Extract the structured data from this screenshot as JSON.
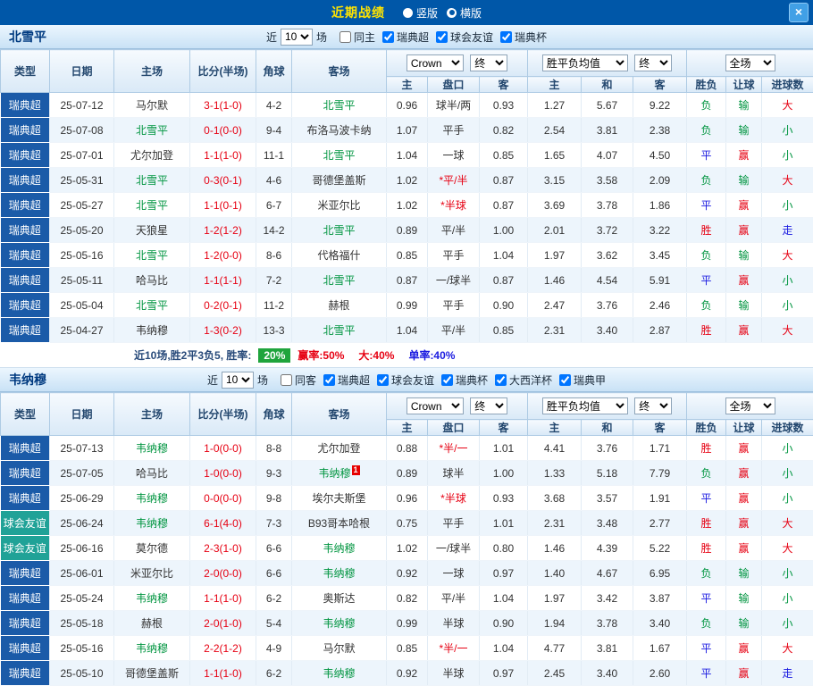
{
  "topbar": {
    "title": "近期战绩",
    "views": [
      {
        "label": "竖版",
        "selected": false
      },
      {
        "label": "横版",
        "selected": true
      }
    ],
    "close": "×"
  },
  "table_header": {
    "type": "类型",
    "date": "日期",
    "home": "主场",
    "score": "比分(半场)",
    "corner": "角球",
    "away": "客场",
    "asian": {
      "bookmaker": "Crown",
      "stage": "终",
      "home": "主",
      "handicap": "盘口",
      "away": "客"
    },
    "europe": {
      "label": "胜平负均值",
      "stage": "终",
      "home": "主",
      "draw": "和",
      "away": "客"
    },
    "result": {
      "label": "全场",
      "wdl": "胜负",
      "handicap": "让球",
      "goals": "进球数"
    }
  },
  "sections": [
    {
      "team": "北雪平",
      "near_label": "近",
      "count": "10",
      "games_label": "场",
      "checkboxes": [
        {
          "label": "同主",
          "checked": false
        },
        {
          "label": "瑞典超",
          "checked": true
        },
        {
          "label": "球会友谊",
          "checked": true
        },
        {
          "label": "瑞典杯",
          "checked": true
        }
      ],
      "rows": [
        {
          "league": "瑞典超",
          "league_type": "super",
          "date": "25-07-12",
          "home": "马尔默",
          "home_focus": false,
          "score": "3-1(1-0)",
          "corner": "4-2",
          "away": "北雪平",
          "away_focus": true,
          "away_card": "",
          "asian_home": "0.96",
          "handicap": "球半/两",
          "handicap_red": false,
          "asian_away": "0.93",
          "euro_home": "1.27",
          "euro_draw": "5.67",
          "euro_away": "9.22",
          "wdl": "负",
          "wdl_c": "green",
          "let": "输",
          "let_c": "green",
          "goal": "大",
          "goal_c": "red"
        },
        {
          "league": "瑞典超",
          "league_type": "super",
          "date": "25-07-08",
          "home": "北雪平",
          "home_focus": true,
          "score": "0-1(0-0)",
          "corner": "9-4",
          "away": "布洛马波卡纳",
          "away_focus": false,
          "away_card": "",
          "asian_home": "1.07",
          "handicap": "平手",
          "handicap_red": false,
          "asian_away": "0.82",
          "euro_home": "2.54",
          "euro_draw": "3.81",
          "euro_away": "2.38",
          "wdl": "负",
          "wdl_c": "green",
          "let": "输",
          "let_c": "green",
          "goal": "小",
          "goal_c": "green"
        },
        {
          "league": "瑞典超",
          "league_type": "super",
          "date": "25-07-01",
          "home": "尤尔加登",
          "home_focus": false,
          "score": "1-1(1-0)",
          "corner": "11-1",
          "away": "北雪平",
          "away_focus": true,
          "away_card": "",
          "asian_home": "1.04",
          "handicap": "一球",
          "handicap_red": false,
          "asian_away": "0.85",
          "euro_home": "1.65",
          "euro_draw": "4.07",
          "euro_away": "4.50",
          "wdl": "平",
          "wdl_c": "blue",
          "let": "赢",
          "let_c": "red",
          "goal": "小",
          "goal_c": "green"
        },
        {
          "league": "瑞典超",
          "league_type": "super",
          "date": "25-05-31",
          "home": "北雪平",
          "home_focus": true,
          "score": "0-3(0-1)",
          "corner": "4-6",
          "away": "哥德堡盖斯",
          "away_focus": false,
          "away_card": "",
          "asian_home": "1.02",
          "handicap": "*平/半",
          "handicap_red": true,
          "asian_away": "0.87",
          "euro_home": "3.15",
          "euro_draw": "3.58",
          "euro_away": "2.09",
          "wdl": "负",
          "wdl_c": "green",
          "let": "输",
          "let_c": "green",
          "goal": "大",
          "goal_c": "red"
        },
        {
          "league": "瑞典超",
          "league_type": "super",
          "date": "25-05-27",
          "home": "北雪平",
          "home_focus": true,
          "score": "1-1(0-1)",
          "corner": "6-7",
          "away": "米亚尔比",
          "away_focus": false,
          "away_card": "",
          "asian_home": "1.02",
          "handicap": "*半球",
          "handicap_red": true,
          "asian_away": "0.87",
          "euro_home": "3.69",
          "euro_draw": "3.78",
          "euro_away": "1.86",
          "wdl": "平",
          "wdl_c": "blue",
          "let": "赢",
          "let_c": "red",
          "goal": "小",
          "goal_c": "green"
        },
        {
          "league": "瑞典超",
          "league_type": "super",
          "date": "25-05-20",
          "home": "天狼星",
          "home_focus": false,
          "score": "1-2(1-2)",
          "corner": "14-2",
          "away": "北雪平",
          "away_focus": true,
          "away_card": "",
          "asian_home": "0.89",
          "handicap": "平/半",
          "handicap_red": false,
          "asian_away": "1.00",
          "euro_home": "2.01",
          "euro_draw": "3.72",
          "euro_away": "3.22",
          "wdl": "胜",
          "wdl_c": "red",
          "let": "赢",
          "let_c": "red",
          "goal": "走",
          "goal_c": "blue"
        },
        {
          "league": "瑞典超",
          "league_type": "super",
          "date": "25-05-16",
          "home": "北雪平",
          "home_focus": true,
          "score": "1-2(0-0)",
          "corner": "8-6",
          "away": "代格福什",
          "away_focus": false,
          "away_card": "",
          "asian_home": "0.85",
          "handicap": "平手",
          "handicap_red": false,
          "asian_away": "1.04",
          "euro_home": "1.97",
          "euro_draw": "3.62",
          "euro_away": "3.45",
          "wdl": "负",
          "wdl_c": "green",
          "let": "输",
          "let_c": "green",
          "goal": "大",
          "goal_c": "red"
        },
        {
          "league": "瑞典超",
          "league_type": "super",
          "date": "25-05-11",
          "home": "哈马比",
          "home_focus": false,
          "score": "1-1(1-1)",
          "corner": "7-2",
          "away": "北雪平",
          "away_focus": true,
          "away_card": "",
          "asian_home": "0.87",
          "handicap": "一/球半",
          "handicap_red": false,
          "asian_away": "0.87",
          "euro_home": "1.46",
          "euro_draw": "4.54",
          "euro_away": "5.91",
          "wdl": "平",
          "wdl_c": "blue",
          "let": "赢",
          "let_c": "red",
          "goal": "小",
          "goal_c": "green"
        },
        {
          "league": "瑞典超",
          "league_type": "super",
          "date": "25-05-04",
          "home": "北雪平",
          "home_focus": true,
          "score": "0-2(0-1)",
          "corner": "11-2",
          "away": "赫根",
          "away_focus": false,
          "away_card": "",
          "asian_home": "0.99",
          "handicap": "平手",
          "handicap_red": false,
          "asian_away": "0.90",
          "euro_home": "2.47",
          "euro_draw": "3.76",
          "euro_away": "2.46",
          "wdl": "负",
          "wdl_c": "green",
          "let": "输",
          "let_c": "green",
          "goal": "小",
          "goal_c": "green"
        },
        {
          "league": "瑞典超",
          "league_type": "super",
          "date": "25-04-27",
          "home": "韦纳穆",
          "home_focus": false,
          "score": "1-3(0-2)",
          "corner": "13-3",
          "away": "北雪平",
          "away_focus": true,
          "away_card": "",
          "asian_home": "1.04",
          "handicap": "平/半",
          "handicap_red": false,
          "asian_away": "0.85",
          "euro_home": "2.31",
          "euro_draw": "3.40",
          "euro_away": "2.87",
          "wdl": "胜",
          "wdl_c": "red",
          "let": "赢",
          "let_c": "red",
          "goal": "大",
          "goal_c": "red"
        }
      ],
      "summary": {
        "prefix": "近10场,胜2平3负5, 胜率:",
        "badge": "20%",
        "stats": [
          {
            "text": "赢率:50%",
            "color": "red"
          },
          {
            "text": "大:40%",
            "color": "red"
          },
          {
            "text": "单率:40%",
            "color": "blue"
          }
        ]
      }
    },
    {
      "team": "韦纳穆",
      "near_label": "近",
      "count": "10",
      "games_label": "场",
      "checkboxes": [
        {
          "label": "同客",
          "checked": false
        },
        {
          "label": "瑞典超",
          "checked": true
        },
        {
          "label": "球会友谊",
          "checked": true
        },
        {
          "label": "瑞典杯",
          "checked": true
        },
        {
          "label": "大西洋杯",
          "checked": true
        },
        {
          "label": "瑞典甲",
          "checked": true
        }
      ],
      "rows": [
        {
          "league": "瑞典超",
          "league_type": "super",
          "date": "25-07-13",
          "home": "韦纳穆",
          "home_focus": true,
          "score": "1-0(0-0)",
          "corner": "8-8",
          "away": "尤尔加登",
          "away_focus": false,
          "away_card": "",
          "asian_home": "0.88",
          "handicap": "*半/一",
          "handicap_red": true,
          "asian_away": "1.01",
          "euro_home": "4.41",
          "euro_draw": "3.76",
          "euro_away": "1.71",
          "wdl": "胜",
          "wdl_c": "red",
          "let": "赢",
          "let_c": "red",
          "goal": "小",
          "goal_c": "green"
        },
        {
          "league": "瑞典超",
          "league_type": "super",
          "date": "25-07-05",
          "home": "哈马比",
          "home_focus": false,
          "score": "1-0(0-0)",
          "corner": "9-3",
          "away": "韦纳穆",
          "away_focus": true,
          "away_card": "1",
          "asian_home": "0.89",
          "handicap": "球半",
          "handicap_red": false,
          "asian_away": "1.00",
          "euro_home": "1.33",
          "euro_draw": "5.18",
          "euro_away": "7.79",
          "wdl": "负",
          "wdl_c": "green",
          "let": "赢",
          "let_c": "red",
          "goal": "小",
          "goal_c": "green"
        },
        {
          "league": "瑞典超",
          "league_type": "super",
          "date": "25-06-29",
          "home": "韦纳穆",
          "home_focus": true,
          "score": "0-0(0-0)",
          "corner": "9-8",
          "away": "埃尔夫斯堡",
          "away_focus": false,
          "away_card": "",
          "asian_home": "0.96",
          "handicap": "*半球",
          "handicap_red": true,
          "asian_away": "0.93",
          "euro_home": "3.68",
          "euro_draw": "3.57",
          "euro_away": "1.91",
          "wdl": "平",
          "wdl_c": "blue",
          "let": "赢",
          "let_c": "red",
          "goal": "小",
          "goal_c": "green"
        },
        {
          "league": "球会友谊",
          "league_type": "friendly",
          "date": "25-06-24",
          "home": "韦纳穆",
          "home_focus": true,
          "score": "6-1(4-0)",
          "corner": "7-3",
          "away": "B93哥本哈根",
          "away_focus": false,
          "away_card": "",
          "asian_home": "0.75",
          "handicap": "平手",
          "handicap_red": false,
          "asian_away": "1.01",
          "euro_home": "2.31",
          "euro_draw": "3.48",
          "euro_away": "2.77",
          "wdl": "胜",
          "wdl_c": "red",
          "let": "赢",
          "let_c": "red",
          "goal": "大",
          "goal_c": "red"
        },
        {
          "league": "球会友谊",
          "league_type": "friendly",
          "date": "25-06-16",
          "home": "莫尔德",
          "home_focus": false,
          "score": "2-3(1-0)",
          "corner": "6-6",
          "away": "韦纳穆",
          "away_focus": true,
          "away_card": "",
          "asian_home": "1.02",
          "handicap": "一/球半",
          "handicap_red": false,
          "asian_away": "0.80",
          "euro_home": "1.46",
          "euro_draw": "4.39",
          "euro_away": "5.22",
          "wdl": "胜",
          "wdl_c": "red",
          "let": "赢",
          "let_c": "red",
          "goal": "大",
          "goal_c": "red"
        },
        {
          "league": "瑞典超",
          "league_type": "super",
          "date": "25-06-01",
          "home": "米亚尔比",
          "home_focus": false,
          "score": "2-0(0-0)",
          "corner": "6-6",
          "away": "韦纳穆",
          "away_focus": true,
          "away_card": "",
          "asian_home": "0.92",
          "handicap": "一球",
          "handicap_red": false,
          "asian_away": "0.97",
          "euro_home": "1.40",
          "euro_draw": "4.67",
          "euro_away": "6.95",
          "wdl": "负",
          "wdl_c": "green",
          "let": "输",
          "let_c": "green",
          "goal": "小",
          "goal_c": "green"
        },
        {
          "league": "瑞典超",
          "league_type": "super",
          "date": "25-05-24",
          "home": "韦纳穆",
          "home_focus": true,
          "score": "1-1(1-0)",
          "corner": "6-2",
          "away": "奥斯达",
          "away_focus": false,
          "away_card": "",
          "asian_home": "0.82",
          "handicap": "平/半",
          "handicap_red": false,
          "asian_away": "1.04",
          "euro_home": "1.97",
          "euro_draw": "3.42",
          "euro_away": "3.87",
          "wdl": "平",
          "wdl_c": "blue",
          "let": "输",
          "let_c": "green",
          "goal": "小",
          "goal_c": "green"
        },
        {
          "league": "瑞典超",
          "league_type": "super",
          "date": "25-05-18",
          "home": "赫根",
          "home_focus": false,
          "score": "2-0(1-0)",
          "corner": "5-4",
          "away": "韦纳穆",
          "away_focus": true,
          "away_card": "",
          "asian_home": "0.99",
          "handicap": "半球",
          "handicap_red": false,
          "asian_away": "0.90",
          "euro_home": "1.94",
          "euro_draw": "3.78",
          "euro_away": "3.40",
          "wdl": "负",
          "wdl_c": "green",
          "let": "输",
          "let_c": "green",
          "goal": "小",
          "goal_c": "green"
        },
        {
          "league": "瑞典超",
          "league_type": "super",
          "date": "25-05-16",
          "home": "韦纳穆",
          "home_focus": true,
          "score": "2-2(1-2)",
          "corner": "4-9",
          "away": "马尔默",
          "away_focus": false,
          "away_card": "",
          "asian_home": "0.85",
          "handicap": "*半/一",
          "handicap_red": true,
          "asian_away": "1.04",
          "euro_home": "4.77",
          "euro_draw": "3.81",
          "euro_away": "1.67",
          "wdl": "平",
          "wdl_c": "blue",
          "let": "赢",
          "let_c": "red",
          "goal": "大",
          "goal_c": "red"
        },
        {
          "league": "瑞典超",
          "league_type": "super",
          "date": "25-05-10",
          "home": "哥德堡盖斯",
          "home_focus": false,
          "score": "1-1(1-0)",
          "corner": "6-2",
          "away": "韦纳穆",
          "away_focus": true,
          "away_card": "",
          "asian_home": "0.92",
          "handicap": "半球",
          "handicap_red": false,
          "asian_away": "0.97",
          "euro_home": "2.45",
          "euro_draw": "3.40",
          "euro_away": "2.60",
          "wdl": "平",
          "wdl_c": "blue",
          "let": "赢",
          "let_c": "red",
          "goal": "走",
          "goal_c": "blue"
        }
      ],
      "summary": null
    }
  ]
}
